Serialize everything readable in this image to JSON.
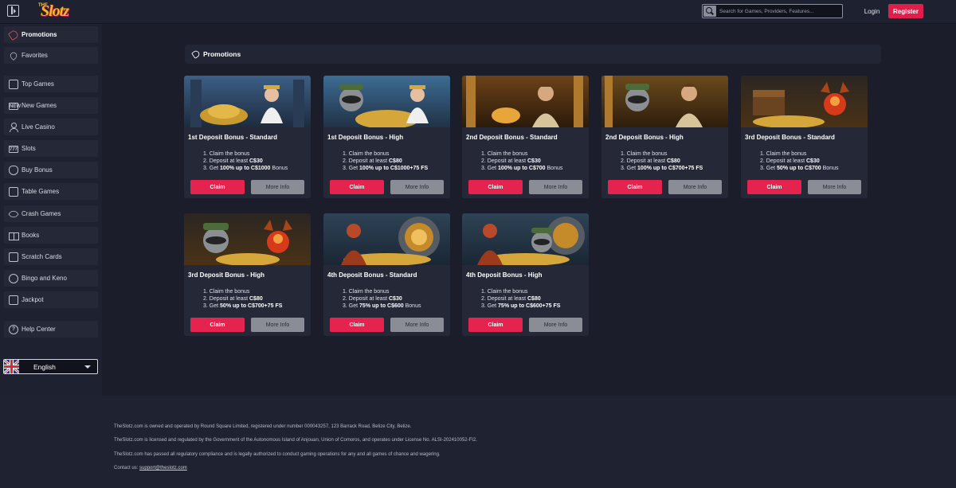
{
  "header": {
    "logo_pre": "THE",
    "logo_main": "Slotz",
    "search_placeholder": "Search for Games, Providers, Features...",
    "login_label": "Login",
    "register_label": "Register"
  },
  "sidebar": {
    "items": [
      {
        "label": "Promotions",
        "icon": "tag-icon"
      },
      {
        "label": "Favorites",
        "icon": "heart-icon"
      },
      {
        "label": "Top Games",
        "icon": "chart-icon"
      },
      {
        "label": "New Games",
        "icon": "new-icon"
      },
      {
        "label": "Live Casino",
        "icon": "person-icon"
      },
      {
        "label": "Slots",
        "icon": "slots-icon"
      },
      {
        "label": "Buy Bonus",
        "icon": "bag-icon"
      },
      {
        "label": "Table Games",
        "icon": "cards-icon"
      },
      {
        "label": "Crash Games",
        "icon": "rocket-icon"
      },
      {
        "label": "Books",
        "icon": "book-icon"
      },
      {
        "label": "Scratch Cards",
        "icon": "scratch-icon"
      },
      {
        "label": "Bingo and Keno",
        "icon": "bingo-icon"
      },
      {
        "label": "Jackpot",
        "icon": "jackpot-icon"
      },
      {
        "label": "Help Center",
        "icon": "help-icon"
      }
    ],
    "language": "English"
  },
  "main": {
    "title": "Promotions",
    "claim_label": "Claim",
    "info_label": "More Info",
    "cards": [
      {
        "title": "1st Deposit Bonus - Standard",
        "step1": "Claim the bonus",
        "step2_pre": "Deposit at least ",
        "step2_val": "C$30",
        "step3_pre": "Get ",
        "step3_val": "100% up to C$1000",
        "step3_post": " Bonus"
      },
      {
        "title": "1st Deposit Bonus - High",
        "step1": "Claim the bonus",
        "step2_pre": "Deposit at least ",
        "step2_val": "C$80",
        "step3_pre": "Get ",
        "step3_val": "100% up to C$1000+75 FS",
        "step3_post": ""
      },
      {
        "title": "2nd Deposit Bonus - Standard",
        "step1": "Claim the bonus",
        "step2_pre": "Deposit at least ",
        "step2_val": "C$30",
        "step3_pre": "Get ",
        "step3_val": "100% up to C$700",
        "step3_post": " Bonus"
      },
      {
        "title": "2nd Deposit Bonus - High",
        "step1": "Claim the bonus",
        "step2_pre": "Deposit at least ",
        "step2_val": "C$80",
        "step3_pre": "Get ",
        "step3_val": "100% up to C$700+75 FS",
        "step3_post": ""
      },
      {
        "title": "3rd Deposit Bonus - Standard",
        "step1": "Claim the bonus",
        "step2_pre": "Deposit at least ",
        "step2_val": "C$30",
        "step3_pre": "Get ",
        "step3_val": "50% up to C$700",
        "step3_post": " Bonus"
      },
      {
        "title": "3rd Deposit Bonus - High",
        "step1": "Claim the bonus",
        "step2_pre": "Deposit at least ",
        "step2_val": "C$80",
        "step3_pre": "Get ",
        "step3_val": "50% up to C$700+75 FS",
        "step3_post": ""
      },
      {
        "title": "4th Deposit Bonus - Standard",
        "step1": "Claim the bonus",
        "step2_pre": "Deposit at least ",
        "step2_val": "C$30",
        "step3_pre": "Get ",
        "step3_val": "75% up to C$600",
        "step3_post": " Bonus"
      },
      {
        "title": "4th Deposit Bonus - High",
        "step1": "Claim the bonus",
        "step2_pre": "Deposit at least ",
        "step2_val": "C$80",
        "step3_pre": "Get ",
        "step3_val": "75% up to C$600+75 FS",
        "step3_post": ""
      }
    ]
  },
  "footer": {
    "line1": "TheSlotz.com is owned and operated by Round Square Limited, registered under number 000043257, 123 Barrack Road, Belize City, Belize.",
    "line2": "TheSlotz.com is licensed and regulated by the Government of the Autonomous Island of Anjouan, Union of Comoros, and operates under License No. ALSI-202410052-FI2.",
    "line3": "TheSlotz.com has passed all regulatory compliance and is legally authorized to conduct gaming operations for any and all games of chance and wagering.",
    "contact_label": "Contact us: ",
    "contact_email": "support@theslotz.com"
  },
  "colors": {
    "accent": "#e5234f",
    "background": "#1b1e2a",
    "panel": "#242837"
  }
}
